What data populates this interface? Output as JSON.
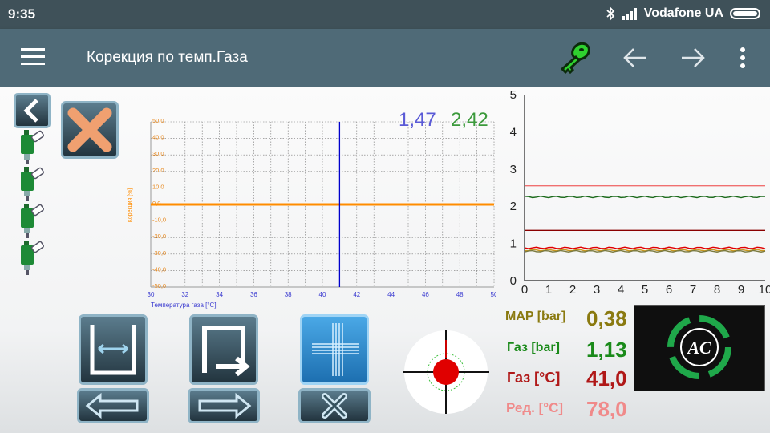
{
  "status": {
    "time": "9:35",
    "carrier": "Vodafone UA"
  },
  "appbar": {
    "title": "Корекция по темп.Газа"
  },
  "icons": {
    "menu": "hamburger-menu-icon",
    "key": "key-icon",
    "back": "arrow-left-icon",
    "forward": "arrow-right-icon",
    "more": "more-vert-icon"
  },
  "colors": {
    "statusbar": "#3f5159",
    "appbar": "#4f6a77",
    "correction_line": "#ff8c00",
    "cursor_line": "#0000cc",
    "value_blue": "#5a5ad6",
    "value_green": "#3c9a3c",
    "map": "#8a7a10",
    "gas_bar": "#1a8a1a",
    "gas_temp": "#b01818",
    "reducer_temp": "#f08a8a"
  },
  "main_chart": {
    "ylabel": "Корекция [%]",
    "xlabel": "Температура газа [°C]",
    "yticks": [
      "50,0",
      "40,0",
      "30,0",
      "20,0",
      "10,0",
      "0,0",
      "-10,0",
      "-20,0",
      "-30,0",
      "-40,0",
      "-50,0"
    ],
    "xticks": [
      "30",
      "32",
      "34",
      "36",
      "38",
      "40",
      "42",
      "44",
      "46",
      "48",
      "50"
    ],
    "cursor_value_1": "1,47",
    "cursor_value_2": "2,42"
  },
  "chart_data": {
    "type": "line",
    "title": "",
    "xlabel": "Температура газа [°C]",
    "ylabel": "Корекция [%]",
    "xlim": [
      30,
      50
    ],
    "ylim": [
      -50,
      50
    ],
    "grid": true,
    "series": [
      {
        "x": [
          30,
          50
        ],
        "values": [
          0,
          0
        ]
      }
    ],
    "cursor_x": 41
  },
  "side_chart": {
    "yticks": [
      "5",
      "4",
      "3",
      "2",
      "1",
      "0"
    ],
    "xticks": [
      "0",
      "1",
      "2",
      "3",
      "4",
      "5",
      "6",
      "7",
      "8",
      "9",
      "10"
    ],
    "xlim": [
      0,
      10
    ],
    "ylim": [
      0,
      5
    ],
    "levels": [
      2.55,
      2.25,
      1.35,
      0.88,
      0.82,
      0.79
    ]
  },
  "readouts": [
    {
      "label": "MAP [bar]",
      "value": "0,38"
    },
    {
      "label": "Газ [bar]",
      "value": "1,13"
    },
    {
      "label": "Газ [°C]",
      "value": "41,0"
    },
    {
      "label": "Ред. [°C]",
      "value": "78,0"
    }
  ],
  "brand": {
    "logo_text": "AC"
  }
}
